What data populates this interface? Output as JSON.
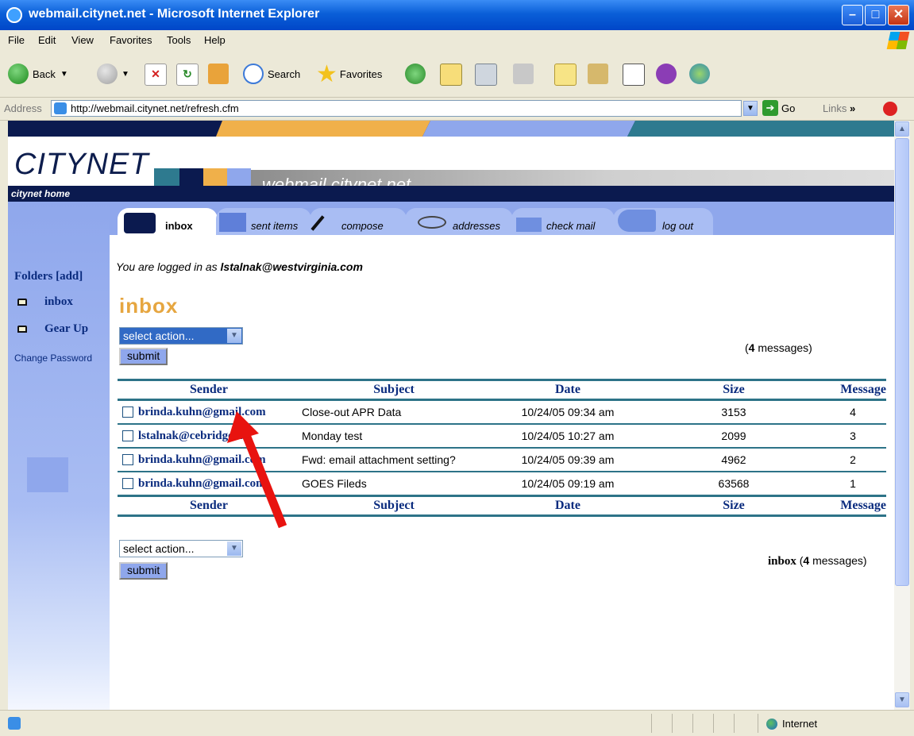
{
  "window": {
    "title": "webmail.citynet.net - Microsoft Internet Explorer"
  },
  "menu": [
    "File",
    "Edit",
    "View",
    "Favorites",
    "Tools",
    "Help"
  ],
  "toolbar": {
    "back": "Back",
    "search": "Search",
    "favorites": "Favorites"
  },
  "address": {
    "label": "Address",
    "url": "http://webmail.citynet.net/refresh.cfm",
    "go": "Go",
    "links": "Links"
  },
  "status": {
    "zone": "Internet"
  },
  "brand": {
    "logo": "CITYNET",
    "site": "webmail.citynet.net",
    "home": "citynet home"
  },
  "tabs": [
    "inbox",
    "sent items",
    "compose",
    "addresses",
    "check mail",
    "log out"
  ],
  "sidebar": {
    "folders_label": "Folders [add]",
    "folders": [
      "inbox",
      "Gear Up"
    ],
    "change_password": "Change Password"
  },
  "main": {
    "logged_in_prefix": "You are logged in as ",
    "logged_in_user": "lstalnak@westvirginia.com",
    "heading": "inbox",
    "select_placeholder": "select action...",
    "submit": "submit",
    "count_top_num": "4",
    "count_top_rest": " messages)",
    "count_bottom_folder": "inbox",
    "count_bottom_num": "4",
    "count_bottom_rest": " messages)"
  },
  "table": {
    "headers": [
      "Sender",
      "Subject",
      "Date",
      "Size",
      "Message"
    ],
    "rows": [
      {
        "sender": "brinda.kuhn@gmail.com",
        "subject": "Close-out APR Data",
        "date": "10/24/05 09:34 am",
        "size": "3153",
        "message": "4"
      },
      {
        "sender": "lstalnak@cebridge.net",
        "subject": "Monday test",
        "date": "10/24/05 10:27 am",
        "size": "2099",
        "message": "3"
      },
      {
        "sender": "brinda.kuhn@gmail.com",
        "subject": "Fwd: email attachment setting?",
        "date": "10/24/05 09:39 am",
        "size": "4962",
        "message": "2"
      },
      {
        "sender": "brinda.kuhn@gmail.com",
        "subject": "GOES Fileds",
        "date": "10/24/05 09:19 am",
        "size": "63568",
        "message": "1"
      }
    ]
  },
  "colors": {
    "accent_orange": "#e6a640",
    "nav_blue": "#8fa7ec",
    "dark_navy": "#0b1a4f",
    "teal": "#2d7388",
    "arrow": "#e8130f"
  }
}
